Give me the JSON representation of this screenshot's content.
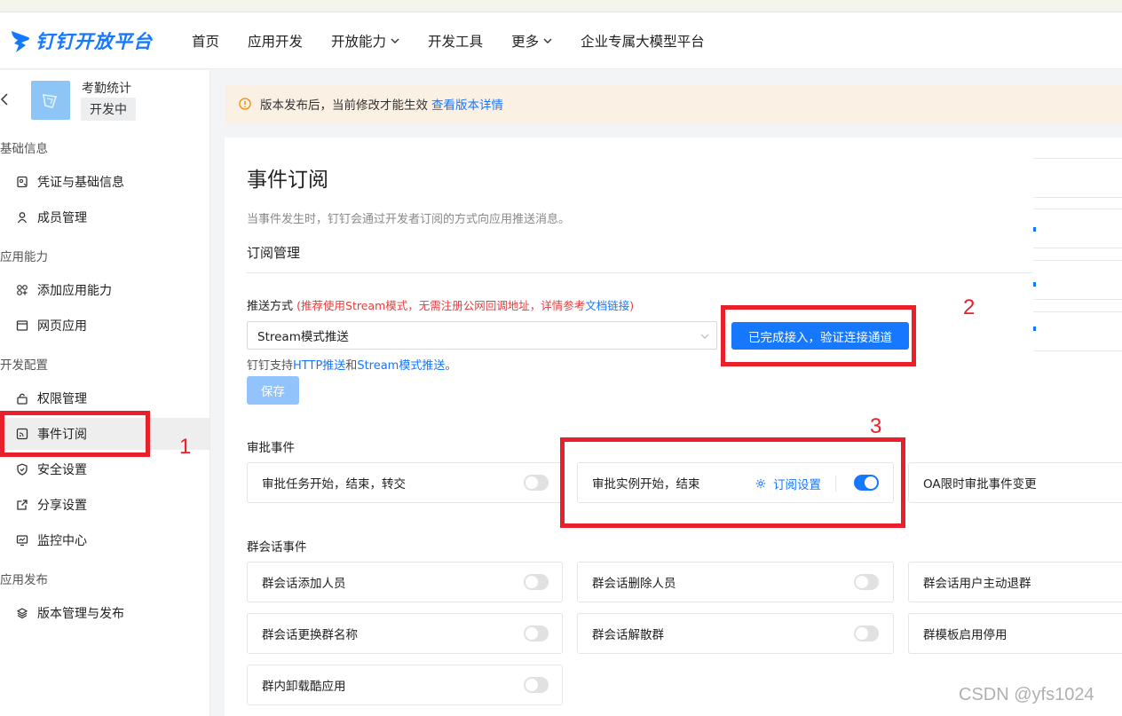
{
  "header": {
    "logo_text": "钉钉开放平台",
    "nav": [
      {
        "label": "首页"
      },
      {
        "label": "应用开发"
      },
      {
        "label": "开放能力"
      },
      {
        "label": "开发工具"
      },
      {
        "label": "更多"
      },
      {
        "label": "企业专属大模型平台"
      }
    ]
  },
  "sidebar": {
    "app_name": "考勤统计",
    "app_status": "开发中",
    "groups": [
      {
        "title": "基础信息",
        "items": [
          {
            "label": "凭证与基础信息"
          },
          {
            "label": "成员管理"
          }
        ]
      },
      {
        "title": "应用能力",
        "items": [
          {
            "label": "添加应用能力"
          },
          {
            "label": "网页应用"
          }
        ]
      },
      {
        "title": "开发配置",
        "items": [
          {
            "label": "权限管理"
          },
          {
            "label": "事件订阅"
          },
          {
            "label": "安全设置"
          },
          {
            "label": "分享设置"
          },
          {
            "label": "监控中心"
          }
        ]
      },
      {
        "title": "应用发布",
        "items": [
          {
            "label": "版本管理与发布"
          }
        ]
      }
    ]
  },
  "banner": {
    "text": "版本发布后，当前修改才能生效",
    "link": "查看版本详情"
  },
  "main": {
    "title": "事件订阅",
    "description": "当事件发生时，钉钉会通过开发者订阅的方式向应用推送消息。",
    "section_title": "订阅管理",
    "push_label": "推送方式",
    "push_hint_prefix": "(推荐使用Stream模式，无需注册公网回调地址，详情参考",
    "push_hint_link": "文档链接",
    "push_hint_suffix": ")",
    "push_mode_value": "Stream模式推送",
    "verify_button": "已完成接入，验证连接通道",
    "support_prefix": "钉钉支持",
    "support_http": "HTTP推送",
    "support_and": "和",
    "support_stream": "Stream模式推送",
    "support_suffix": "。",
    "save_button": "保存",
    "approval_title": "审批事件",
    "approval_events": [
      {
        "label": "审批任务开始，结束，转交",
        "enabled": false
      },
      {
        "label": "审批实例开始，结束",
        "enabled": true,
        "setting_label": "订阅设置"
      },
      {
        "label": "OA限时审批事件变更"
      }
    ],
    "group_title": "群会话事件",
    "group_events": [
      {
        "label": "群会话添加人员",
        "enabled": false
      },
      {
        "label": "群会话删除人员",
        "enabled": false
      },
      {
        "label": "群会话用户主动退群"
      },
      {
        "label": "群会话更换群名称",
        "enabled": false
      },
      {
        "label": "群会话解散群",
        "enabled": false
      },
      {
        "label": "群模板启用停用"
      },
      {
        "label": "群内卸载酷应用",
        "enabled": false
      }
    ]
  },
  "annotations": [
    "1",
    "2",
    "3"
  ],
  "watermark": "CSDN @yfs1024",
  "colors": {
    "accent": "#1677ff",
    "annotation_red": "#e8202a",
    "banner_bg": "#fbf0e4"
  }
}
